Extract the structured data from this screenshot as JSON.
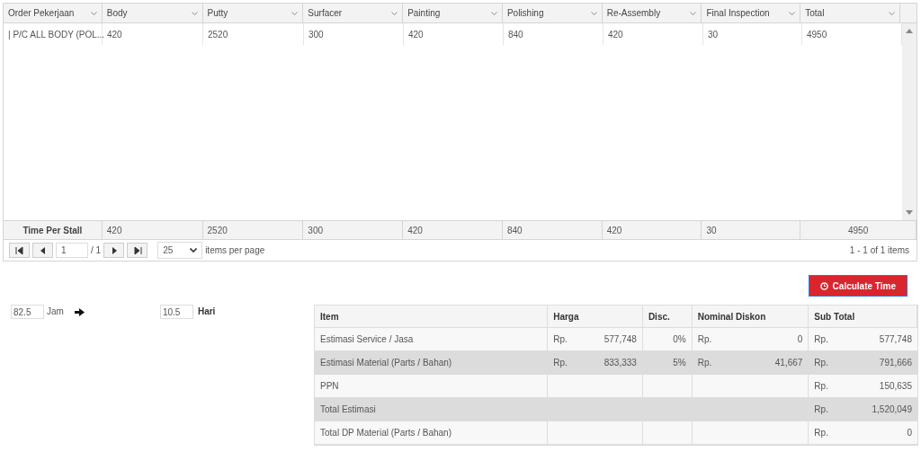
{
  "grid": {
    "columns": [
      "Order Pekerjaan",
      "Body",
      "Putty",
      "Surfacer",
      "Painting",
      "Polishing",
      "Re-Assembly",
      "Final Inspection",
      "Total"
    ],
    "rows": [
      [
        "| P/C ALL BODY (POL...",
        "420",
        "2520",
        "300",
        "420",
        "840",
        "420",
        "30",
        "4950"
      ]
    ],
    "footer": [
      "Time Per Stall",
      "420",
      "2520",
      "300",
      "420",
      "840",
      "420",
      "30",
      "4950"
    ],
    "pager": {
      "page": "1",
      "of": "/ 1",
      "page_size": "25",
      "page_size_label": "items per page",
      "info": "1 - 1 of 1 items"
    }
  },
  "calculate_button": "Calculate Time",
  "hours": {
    "value": "82.5",
    "unit": "Jam"
  },
  "days": {
    "value": "10.5",
    "unit": "Hari"
  },
  "summary": {
    "columns": [
      "Item",
      "Harga",
      "Disc.",
      "Nominal Diskon",
      "Sub Total"
    ],
    "rows": [
      {
        "item": "Estimasi Service / Jasa",
        "price": {
          "currency": "Rp.",
          "amount": "577,748"
        },
        "disc": "0%",
        "discount": {
          "currency": "Rp.",
          "amount": "0"
        },
        "subtotal": {
          "currency": "Rp.",
          "amount": "577,748"
        }
      },
      {
        "item": "Estimasi Material (Parts / Bahan)",
        "price": {
          "currency": "Rp.",
          "amount": "833,333"
        },
        "disc": "5%",
        "discount": {
          "currency": "Rp.",
          "amount": "41,667"
        },
        "subtotal": {
          "currency": "Rp.",
          "amount": "791,666"
        }
      },
      {
        "item": "PPN",
        "subtotal": {
          "currency": "Rp.",
          "amount": "150,635"
        }
      },
      {
        "item": "Total Estimasi",
        "merged": true,
        "subtotal": {
          "currency": "Rp.",
          "amount": "1,520,049"
        }
      },
      {
        "item": "Total DP Material (Parts / Bahan)",
        "subtotal": {
          "currency": "Rp.",
          "amount": "0"
        }
      }
    ]
  }
}
